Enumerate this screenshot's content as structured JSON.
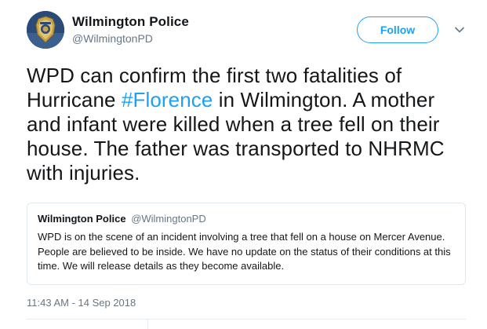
{
  "author": {
    "display_name": "Wilmington Police",
    "handle": "@WilmingtonPD",
    "avatar_icon": "police-badge-icon"
  },
  "follow_button": {
    "label": "Follow"
  },
  "menu": {
    "icon": "chevron-down-icon"
  },
  "tweet": {
    "text_before": "WPD can confirm the first two fatalities of Hurricane ",
    "hashtag": "#Florence",
    "text_after": " in Wilmington. A mother and infant were killed when a tree fell on their house. The father was transported to NHRMC with injuries."
  },
  "quoted_tweet": {
    "display_name": "Wilmington Police",
    "handle": "@WilmingtonPD",
    "text": "WPD is on the scene of an incident involving a tree that fell on a house on Mercer Avenue. People are believed to be inside. We have no update on the status of their conditions at this time. We will release details as they become available."
  },
  "timestamp": "11:43 AM - 14 Sep 2018",
  "colors": {
    "accent": "#1da1f2",
    "text_primary": "#14171a",
    "text_secondary": "#657786",
    "border": "#e1e8ed"
  }
}
